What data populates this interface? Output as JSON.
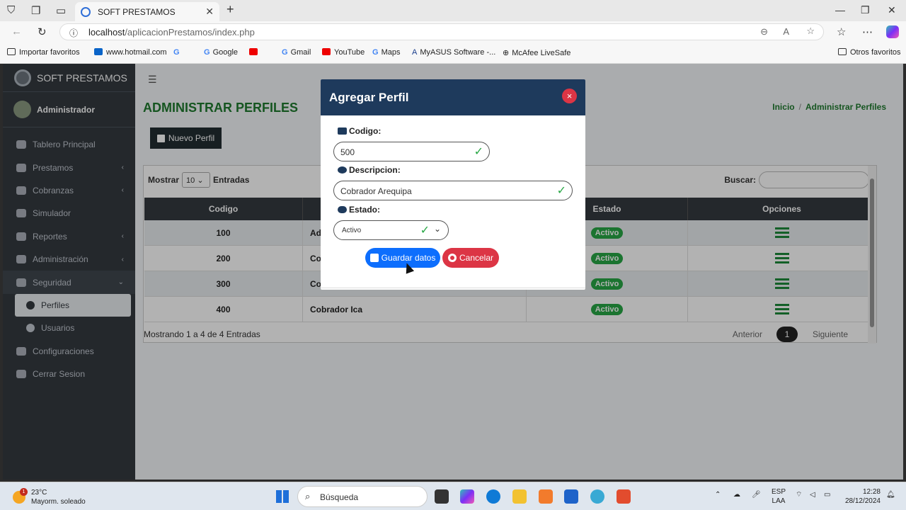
{
  "browser": {
    "tab_title": "SOFT PRESTAMOS",
    "url_host": "localhost",
    "url_path": "/aplicacionPrestamos/index.php",
    "bookmarks": [
      "Importar favoritos",
      "www.hotmail.com",
      "Google",
      "Gmail",
      "YouTube",
      "Maps",
      "MyASUS Software -...",
      "McAfee LiveSafe"
    ],
    "other_bookmarks": "Otros favoritos"
  },
  "app": {
    "brand": "SOFT PRESTAMOS",
    "user": "Administrador",
    "nav": [
      {
        "label": "Tablero Principal",
        "arrow": ""
      },
      {
        "label": "Prestamos",
        "arrow": "‹"
      },
      {
        "label": "Cobranzas",
        "arrow": "‹"
      },
      {
        "label": "Simulador",
        "arrow": ""
      },
      {
        "label": "Reportes",
        "arrow": "‹"
      },
      {
        "label": "Administración",
        "arrow": "‹"
      },
      {
        "label": "Seguridad",
        "arrow": "⌄"
      }
    ],
    "subnav": [
      "Perfiles",
      "Usuarios"
    ],
    "nav_bottom": [
      "Configuraciones",
      "Cerrar Sesion"
    ],
    "page_title": "ADMINISTRAR PERFILES",
    "breadcrumb": {
      "home": "Inicio",
      "sep": "/",
      "current": "Administrar Perfiles"
    },
    "new_button": "Nuevo Perfil",
    "mostrar": "Mostrar",
    "page_size": "10",
    "entradas": "Entradas",
    "buscar": "Buscar:",
    "columns": [
      "Codigo",
      "",
      "",
      "Estado",
      "Opciones"
    ],
    "rows": [
      {
        "codigo": "100",
        "descripcion": "Adr",
        "estado": "Activo"
      },
      {
        "codigo": "200",
        "descripcion": "Col",
        "estado": "Activo"
      },
      {
        "codigo": "300",
        "descripcion": "Col",
        "estado": "Activo"
      },
      {
        "codigo": "400",
        "descripcion": "Cobrador Ica",
        "estado": "Activo"
      }
    ],
    "footer_info": "Mostrando 1 a 4 de 4 Entradas",
    "pagination": {
      "prev": "Anterior",
      "page": "1",
      "next": "Siguiente"
    }
  },
  "modal": {
    "title": "Agregar Perfil",
    "close": "×",
    "codigo_label": "Codigo:",
    "codigo_value": "500",
    "descripcion_label": "Descripcion:",
    "descripcion_value": "Cobrador Arequipa",
    "estado_label": "Estado:",
    "estado_value": "Activo",
    "save": "Guardar datos",
    "cancel": "Cancelar"
  },
  "taskbar": {
    "temp": "23°C",
    "weather": "Mayorm. soleado",
    "badge": "1",
    "search": "Búsqueda",
    "lang1": "ESP",
    "lang2": "LAA",
    "time": "12:28",
    "date": "28/12/2024"
  },
  "colors": {
    "sidebar": "#343a40",
    "accent_green": "#1f7a2e",
    "modal_header": "#1e3a5c",
    "save": "#0d6efd",
    "cancel": "#dc3545"
  }
}
